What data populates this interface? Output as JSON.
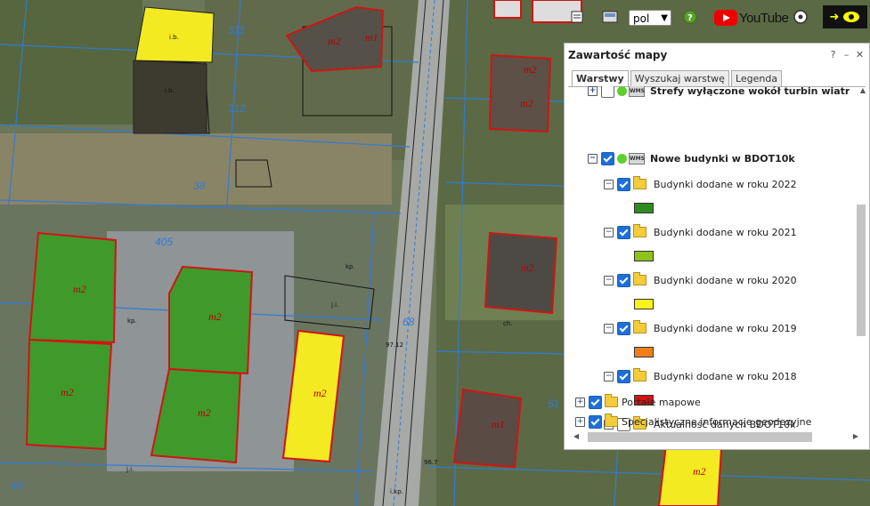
{
  "map": {
    "labels_m2": [
      {
        "text": "m2"
      },
      {
        "text": "m2"
      },
      {
        "text": "m2"
      },
      {
        "text": "m2"
      },
      {
        "text": "m2"
      },
      {
        "text": "m2"
      },
      {
        "text": "m2"
      },
      {
        "text": "m2"
      },
      {
        "text": "m1"
      },
      {
        "text": "m1"
      },
      {
        "text": "m2"
      },
      {
        "text": "m2"
      }
    ],
    "plot_numbers": [
      "311",
      "312",
      "38",
      "405",
      "68",
      "51",
      "48"
    ],
    "misc_labels": [
      "i.b.",
      "i.b.",
      "kp.",
      "kp.",
      "j.i.",
      "ch.",
      "j.i.",
      "i.kp.",
      "97.12",
      "96.7"
    ]
  },
  "toolbar": {
    "language": "pol",
    "youtube_label": "YouTube",
    "help_label": "?"
  },
  "panel": {
    "title": "Zawartość mapy",
    "btn_help": "?",
    "btn_min": "–",
    "btn_close": "✕",
    "tabs": [
      "Warstwy",
      "Wyszukaj warstwę",
      "Legenda"
    ],
    "tree": [
      {
        "label": "Strefy wyłączone wokół turbin wiatrowych"
      },
      {
        "label": "Nowe budynki w BDOT10k"
      },
      {
        "label": "Budynki dodane w roku 2022"
      },
      {
        "label": "Budynki dodane w roku 2021"
      },
      {
        "label": "Budynki dodane w roku 2020"
      },
      {
        "label": "Budynki dodane w roku 2019"
      },
      {
        "label": "Budynki dodane w roku 2018"
      },
      {
        "label": "Aktualność danych BDOT10k"
      },
      {
        "label": "Portale mapowe"
      },
      {
        "label": "Specjalistyczne informacje geodezyjne"
      }
    ],
    "colors": {
      "2022": "#2e8b1f",
      "2021": "#8fc21a",
      "2020": "#f7f21c",
      "2019": "#f07f1a",
      "2018": "#d11414"
    },
    "wms_icon_text": "WMS"
  }
}
